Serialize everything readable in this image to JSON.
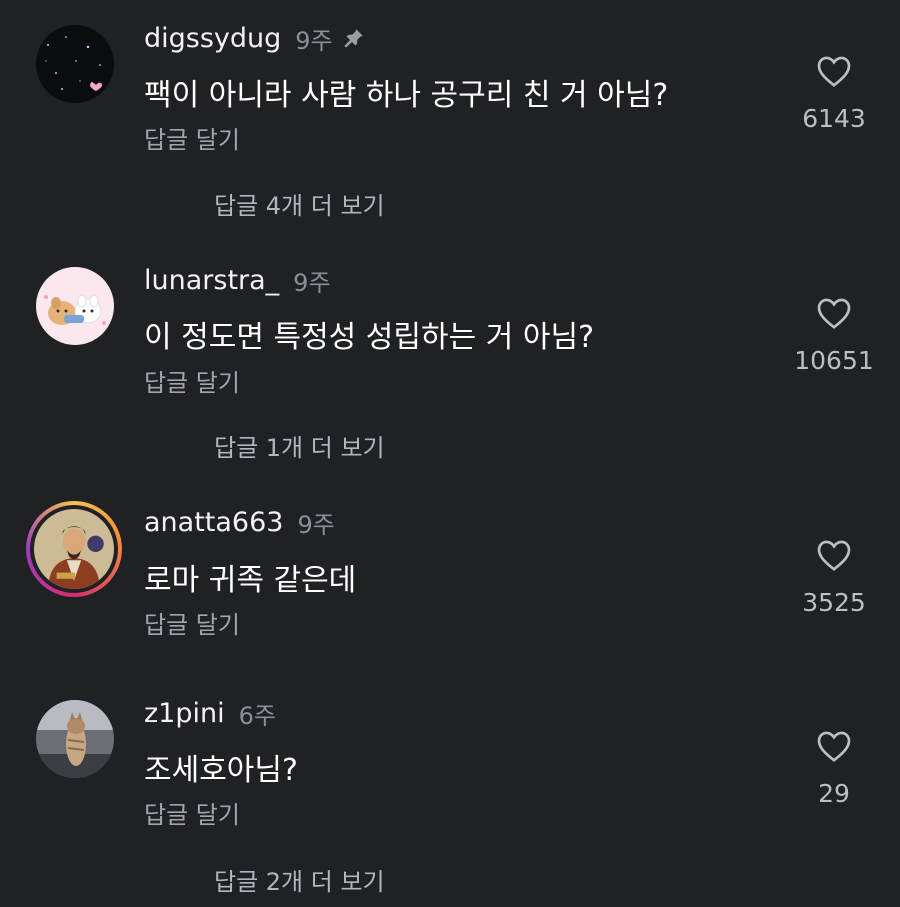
{
  "comments": [
    {
      "username": "digssydug",
      "time": "9주",
      "pinned": true,
      "text": "팩이 아니라 사람 하나 공구리 친 거 아님?",
      "reply": "답글 달기",
      "likes": "6143",
      "more": "답글 4개 더 보기"
    },
    {
      "username": "lunarstra_",
      "time": "9주",
      "pinned": false,
      "text": "이 정도면 특정성 성립하는 거 아님?",
      "reply": "답글 달기",
      "likes": "10651",
      "more": "답글 1개 더 보기"
    },
    {
      "username": "anatta663",
      "time": "9주",
      "pinned": false,
      "text": "로마 귀족 같은데",
      "reply": "답글 달기",
      "likes": "3525",
      "more": ""
    },
    {
      "username": "z1pini",
      "time": "6주",
      "pinned": false,
      "text": "조세호아님?",
      "reply": "답글 달기",
      "likes": "29",
      "more": "답글 2개 더 보기"
    }
  ],
  "icons": {
    "like": "heart-outline-icon",
    "pin": "pin-icon"
  },
  "colors": {
    "background": "#202125",
    "secondary_text": "#8d8e93"
  }
}
